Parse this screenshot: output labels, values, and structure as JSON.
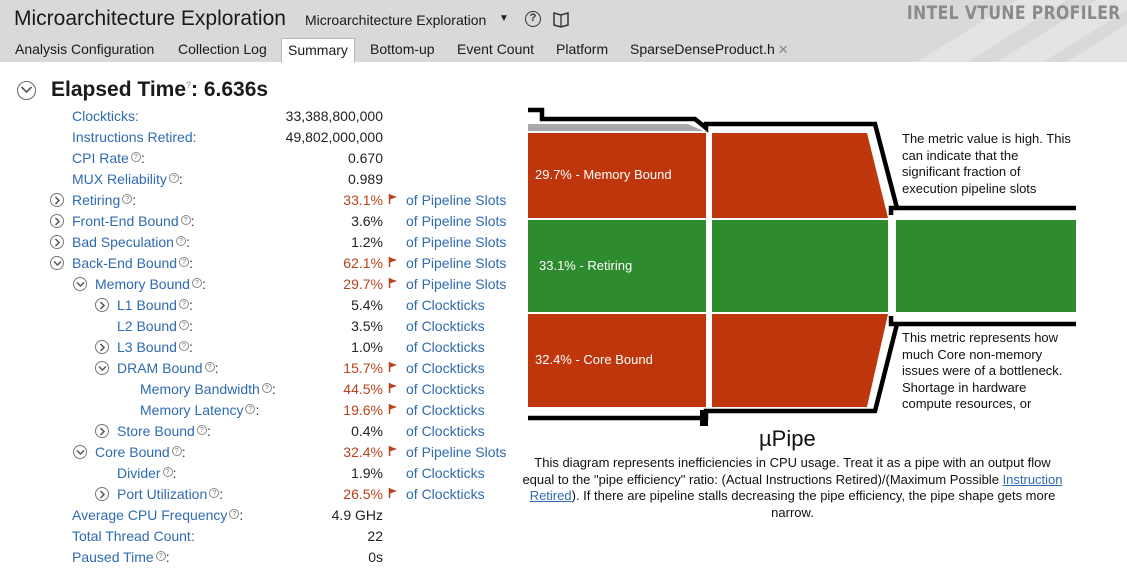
{
  "header": {
    "app_title": "Microarchitecture Exploration",
    "analysis_selector": "Microarchitecture Exploration",
    "brand": "INTEL VTUNE PROFILER",
    "tabs": [
      {
        "label": "Analysis Configuration",
        "active": false
      },
      {
        "label": "Collection Log",
        "active": false
      },
      {
        "label": "Summary",
        "active": true
      },
      {
        "label": "Bottom-up",
        "active": false
      },
      {
        "label": "Event Count",
        "active": false
      },
      {
        "label": "Platform",
        "active": false
      },
      {
        "label": "SparseDenseProduct.h",
        "active": false,
        "closable": true
      }
    ]
  },
  "summary": {
    "title": "Elapsed Time",
    "value": ": 6.636s",
    "metrics": [
      {
        "label": "Clockticks:",
        "value": "33,388,800,000",
        "unit": "",
        "help": false
      },
      {
        "label": "Instructions Retired:",
        "value": "49,802,000,000",
        "unit": "",
        "help": false
      },
      {
        "label": "CPI Rate",
        "value": "0.670",
        "unit": "",
        "help": true
      },
      {
        "label": "MUX Reliability",
        "value": "0.989",
        "unit": "",
        "help": true
      },
      {
        "label": "Retiring",
        "value": "33.1%",
        "unit": "of Pipeline Slots",
        "help": true
      },
      {
        "label": "Front-End Bound",
        "value": "3.6%",
        "unit": "of Pipeline Slots",
        "help": true
      },
      {
        "label": "Bad Speculation",
        "value": "1.2%",
        "unit": "of Pipeline Slots",
        "help": true
      },
      {
        "label": "Back-End Bound",
        "value": "62.1%",
        "unit": "of Pipeline Slots",
        "help": true
      },
      {
        "label": "Memory Bound",
        "value": "29.7%",
        "unit": "of Pipeline Slots",
        "help": true
      },
      {
        "label": "L1 Bound",
        "value": "5.4%",
        "unit": "of Clockticks",
        "help": true
      },
      {
        "label": "L2 Bound",
        "value": "3.5%",
        "unit": "of Clockticks",
        "help": true
      },
      {
        "label": "L3 Bound",
        "value": "1.0%",
        "unit": "of Clockticks",
        "help": true
      },
      {
        "label": "DRAM Bound",
        "value": "15.7%",
        "unit": "of Clockticks",
        "help": true
      },
      {
        "label": "Memory Bandwidth",
        "value": "44.5%",
        "unit": "of Clockticks",
        "help": true
      },
      {
        "label": "Memory Latency",
        "value": "19.6%",
        "unit": "of Clockticks",
        "help": true
      },
      {
        "label": "Store Bound",
        "value": "0.4%",
        "unit": "of Clockticks",
        "help": true
      },
      {
        "label": "Core Bound",
        "value": "32.4%",
        "unit": "of Pipeline Slots",
        "help": true
      },
      {
        "label": "Divider",
        "value": "1.9%",
        "unit": "of Clockticks",
        "help": true
      },
      {
        "label": "Port Utilization",
        "value": "26.5%",
        "unit": "of Clockticks",
        "help": true
      },
      {
        "label": "Average CPU Frequency",
        "value": "4.9 GHz",
        "unit": "",
        "help": true
      },
      {
        "label": "Total Thread Count:",
        "value": "22",
        "unit": "",
        "help": false
      },
      {
        "label": "Paused Time",
        "value": "0s",
        "unit": "",
        "help": true
      }
    ]
  },
  "pipe": {
    "memory_bound_label": "29.7% - Memory Bound",
    "retiring_label": "33.1% - Retiring",
    "core_bound_label": "32.4% - Core Bound",
    "note_top": "The metric value is high. This can indicate that the significant fraction of execution pipeline slots",
    "note_bottom": "This metric represents how much Core non-memory issues were of a bottleneck. Shortage in hardware compute resources, or",
    "title": "µPipe",
    "desc_before": "This diagram represents inefficiencies in CPU usage. Treat it as a pipe with an output flow equal to the \"pipe efficiency\" ratio: (Actual Instructions Retired)/(Maximum Possible ",
    "desc_link": "Instruction Retired",
    "desc_after": "). If there are pipeline stalls decreasing the pipe efficiency, the pipe shape gets more narrow."
  },
  "colors": {
    "bound": "#c0360c",
    "retiring": "#2e8b2e",
    "link": "#2e6bb0",
    "hot": "#b8431e"
  }
}
